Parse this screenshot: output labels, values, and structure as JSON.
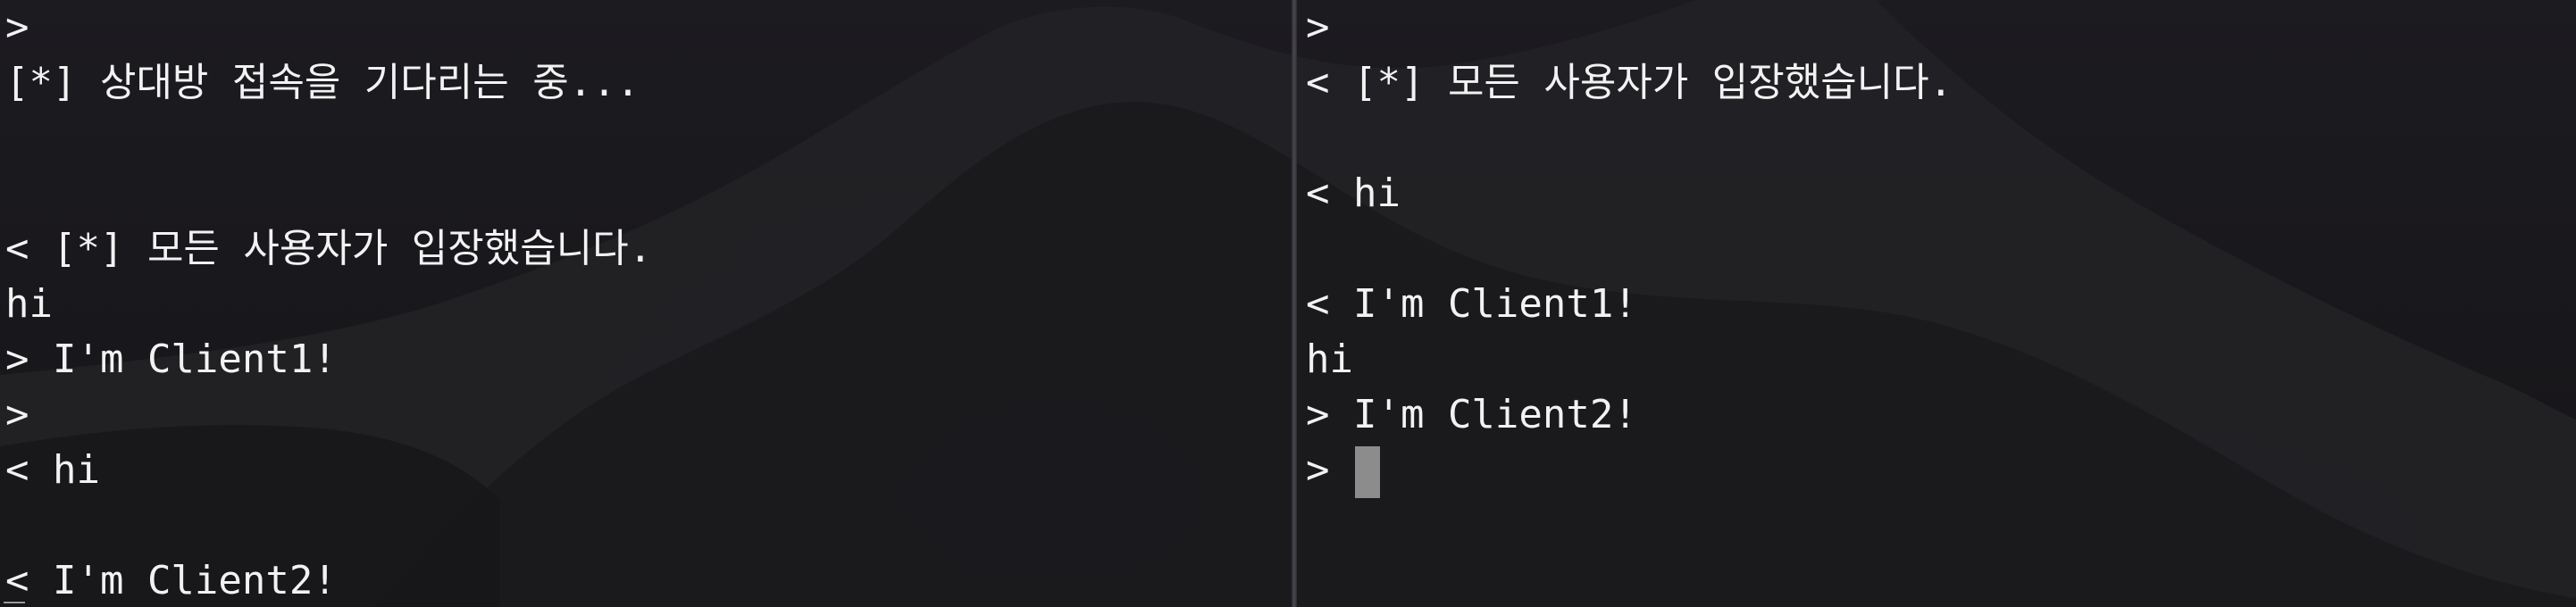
{
  "left_terminal": {
    "lines": [
      ">",
      "[*] 상대방 접속을 기다리는 중...",
      "",
      "",
      "< [*] 모든 사용자가 입장했습니다.",
      "hi",
      "> I'm Client1!",
      ">",
      "< hi",
      "",
      "< I'm Client2!"
    ]
  },
  "right_terminal": {
    "lines": [
      ">",
      "< [*] 모든 사용자가 입장했습니다.",
      "",
      "< hi",
      "",
      "< I'm Client1!",
      "hi",
      "> I'm Client2!",
      ">"
    ]
  },
  "colors": {
    "text": "#f2f2f2",
    "cursor": "#8c8c8c",
    "background": "#1b1a1e"
  }
}
